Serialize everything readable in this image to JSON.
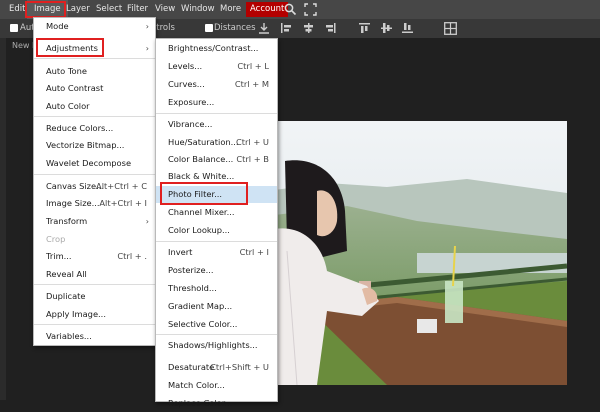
{
  "menubar": {
    "items": [
      "Edit",
      "Image",
      "Layer",
      "Select",
      "Filter",
      "View",
      "Window",
      "More"
    ],
    "account": "Account"
  },
  "optbar": {
    "auto_label": "Auto",
    "transform_controls": "Transform controls",
    "distances": "Distances"
  },
  "document": {
    "tab_label": "New P"
  },
  "image_menu": {
    "items": [
      {
        "label": "Mode",
        "submenu": true
      },
      {
        "label": "Adjustments",
        "submenu": true,
        "highlighted": true
      },
      {
        "label": "Auto Tone"
      },
      {
        "label": "Auto Contrast"
      },
      {
        "label": "Auto Color"
      },
      {
        "label": "Reduce Colors..."
      },
      {
        "label": "Vectorize Bitmap..."
      },
      {
        "label": "Wavelet Decompose"
      },
      {
        "label": "Canvas Size...",
        "shortcut": "Alt+Ctrl + C"
      },
      {
        "label": "Image Size...",
        "shortcut": "Alt+Ctrl + I"
      },
      {
        "label": "Transform",
        "submenu": true
      },
      {
        "label": "Crop",
        "disabled": true
      },
      {
        "label": "Trim...",
        "shortcut": "Ctrl + ."
      },
      {
        "label": "Reveal All"
      },
      {
        "label": "Duplicate"
      },
      {
        "label": "Apply Image..."
      },
      {
        "label": "Variables..."
      }
    ]
  },
  "adjustments_menu": {
    "items": [
      {
        "label": "Brightness/Contrast..."
      },
      {
        "label": "Levels...",
        "shortcut": "Ctrl + L"
      },
      {
        "label": "Curves...",
        "shortcut": "Ctrl + M"
      },
      {
        "label": "Exposure..."
      },
      {
        "label": "Vibrance..."
      },
      {
        "label": "Hue/Saturation...",
        "shortcut": "Ctrl + U"
      },
      {
        "label": "Color Balance...",
        "shortcut": "Ctrl + B"
      },
      {
        "label": "Black & White..."
      },
      {
        "label": "Photo Filter...",
        "active": true
      },
      {
        "label": "Channel Mixer..."
      },
      {
        "label": "Color Lookup..."
      },
      {
        "label": "Invert",
        "shortcut": "Ctrl + I"
      },
      {
        "label": "Posterize..."
      },
      {
        "label": "Threshold..."
      },
      {
        "label": "Gradient Map..."
      },
      {
        "label": "Selective Color..."
      },
      {
        "label": "Shadows/Highlights..."
      },
      {
        "label": "Desaturate",
        "shortcut": "Ctrl+Shift + U"
      },
      {
        "label": "Match Color..."
      },
      {
        "label": "Replace Color..."
      }
    ]
  },
  "colors": {
    "account_bg": "#b30000",
    "highlight_border": "#e02020",
    "active_item_bg": "#cfe3f4"
  }
}
